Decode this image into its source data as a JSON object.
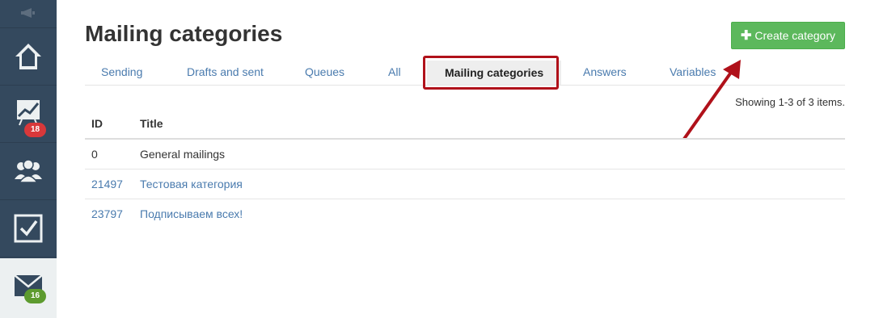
{
  "sidebar": {
    "items": [
      {
        "icon": "megaphone-icon"
      },
      {
        "icon": "home-icon"
      },
      {
        "icon": "chart-icon",
        "badge": "18"
      },
      {
        "icon": "users-icon"
      },
      {
        "icon": "checkbox-icon"
      },
      {
        "icon": "mail-icon",
        "badge": "16"
      }
    ]
  },
  "page": {
    "title": "Mailing categories",
    "create_button": "Create category"
  },
  "tabs": [
    {
      "label": "Sending"
    },
    {
      "label": "Drafts and sent"
    },
    {
      "label": "Queues"
    },
    {
      "label": "All"
    },
    {
      "label": "Mailing categories",
      "active": true
    },
    {
      "label": "Answers"
    },
    {
      "label": "Variables"
    }
  ],
  "table": {
    "summary": "Showing 1-3 of 3 items.",
    "headers": {
      "id": "ID",
      "title": "Title"
    },
    "rows": [
      {
        "id": "0",
        "title": "General mailings"
      },
      {
        "id": "21497",
        "title": "Тестовая категория"
      },
      {
        "id": "23797",
        "title": "Подписываем всех!"
      }
    ]
  },
  "colors": {
    "sidebar": "#34495e",
    "accent_green": "#5cb85c",
    "link": "#4a7bae",
    "annotation_red": "#b0111a",
    "badge_red": "#d9383a",
    "badge_green": "#5d9b2f"
  }
}
